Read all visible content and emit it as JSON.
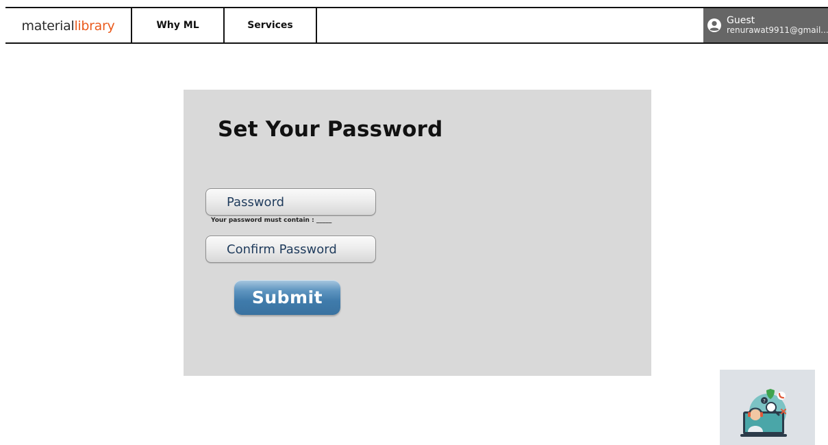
{
  "header": {
    "logo": {
      "part1": "material",
      "part2": "library"
    },
    "nav": [
      {
        "label": "Why ML"
      },
      {
        "label": "Services"
      }
    ],
    "user": {
      "name": "Guest",
      "email": "renurawat9911@gmail..."
    }
  },
  "form": {
    "title": "Set Your Password",
    "password_label": "Password",
    "password_hint": "Your password must contain : _____",
    "confirm_label": "Confirm Password",
    "submit_label": "Submit"
  },
  "colors": {
    "brand_orange": "#ea5a1c",
    "card_background": "#d9d9d9",
    "user_box": "#666666",
    "submit_button": "#3f7bab",
    "field_text": "#1f3b5c"
  },
  "icons": {
    "user": "user-circle-icon",
    "support": "customer-support-icon"
  }
}
